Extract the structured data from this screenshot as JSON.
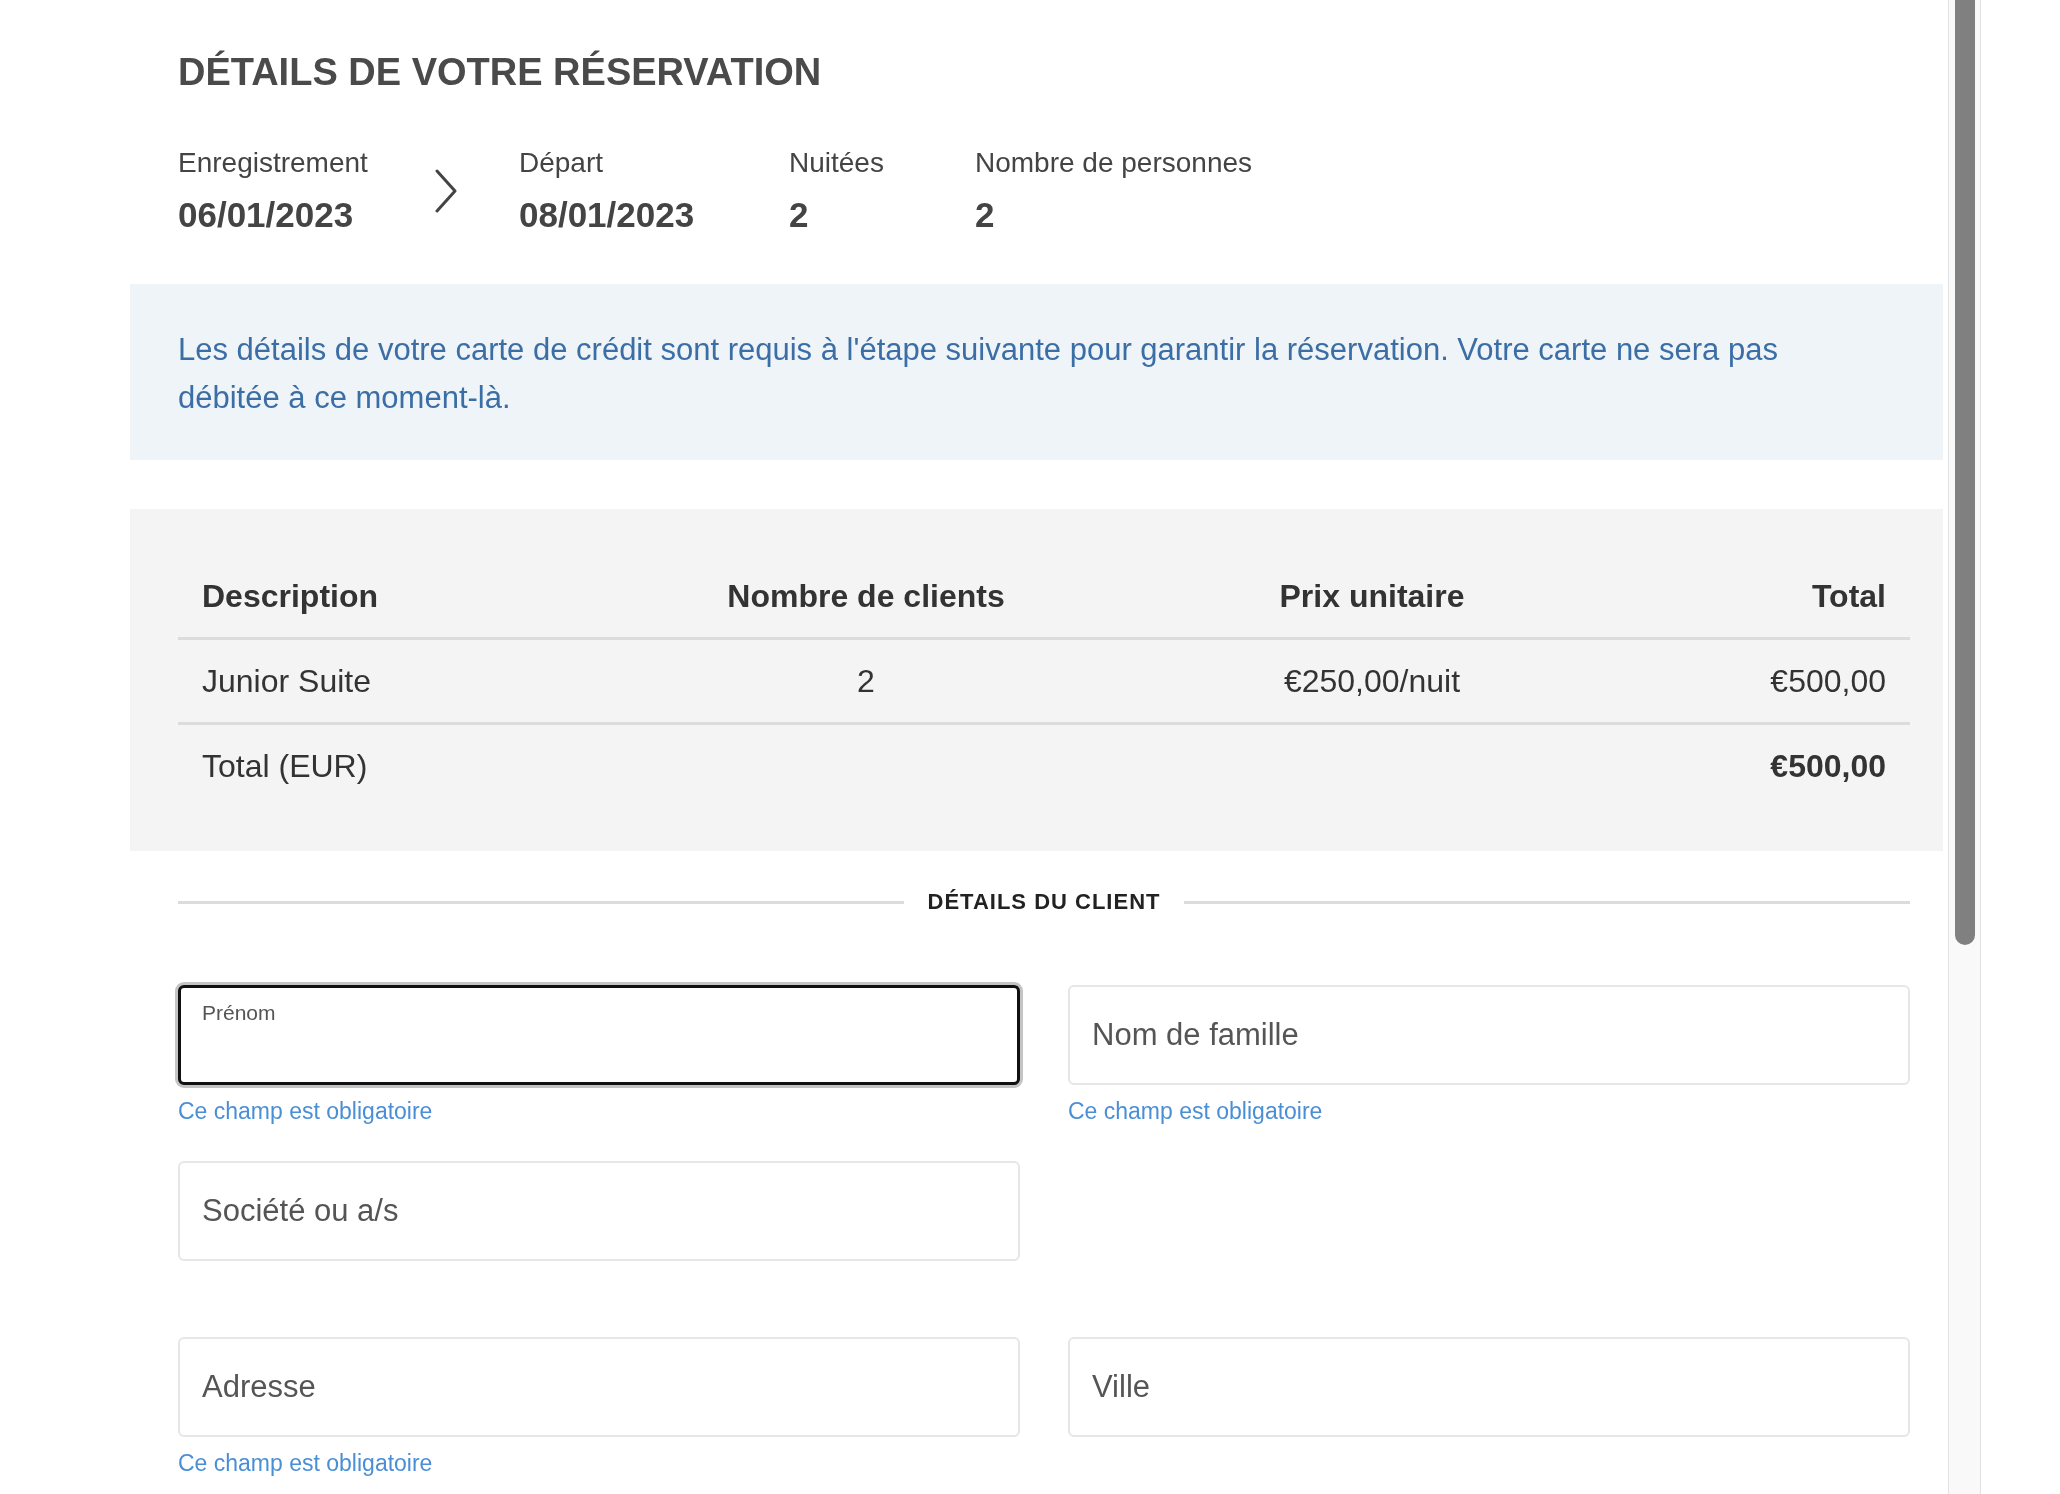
{
  "title": "DÉTAILS DE VOTRE RÉSERVATION",
  "stay": [
    {
      "label": "Enregistrement",
      "value": "06/01/2023"
    },
    {
      "label": "Départ",
      "value": "08/01/2023"
    },
    {
      "label": "Nuitées",
      "value": "2"
    },
    {
      "label": "Nombre de personnes",
      "value": "2"
    }
  ],
  "notice": "Les détails de votre carte de crédit sont requis à l'étape suivante pour garantir la réservation. Votre carte ne sera pas débitée à ce moment-là.",
  "table": {
    "columns": [
      "Description",
      "Nombre de clients",
      "Prix unitaire",
      "Total"
    ],
    "rows": [
      [
        "Junior Suite",
        "2",
        "€250,00/nuit",
        "€500,00"
      ]
    ],
    "total": {
      "label": "Total (EUR)",
      "value": "€500,00"
    }
  },
  "section_title": "DÉTAILS DU CLIENT",
  "form_rows": [
    [
      {
        "placeholder": "Prénom",
        "focused": true,
        "error": "Ce champ est obligatoire"
      },
      {
        "placeholder": "Nom de famille",
        "focused": false,
        "error": "Ce champ est obligatoire"
      }
    ],
    [
      {
        "placeholder": "Société ou a/s",
        "focused": false
      }
    ],
    [
      {
        "placeholder": "Adresse",
        "focused": false,
        "error": "Ce champ est obligatoire"
      },
      {
        "placeholder": "Ville",
        "focused": false
      }
    ]
  ]
}
